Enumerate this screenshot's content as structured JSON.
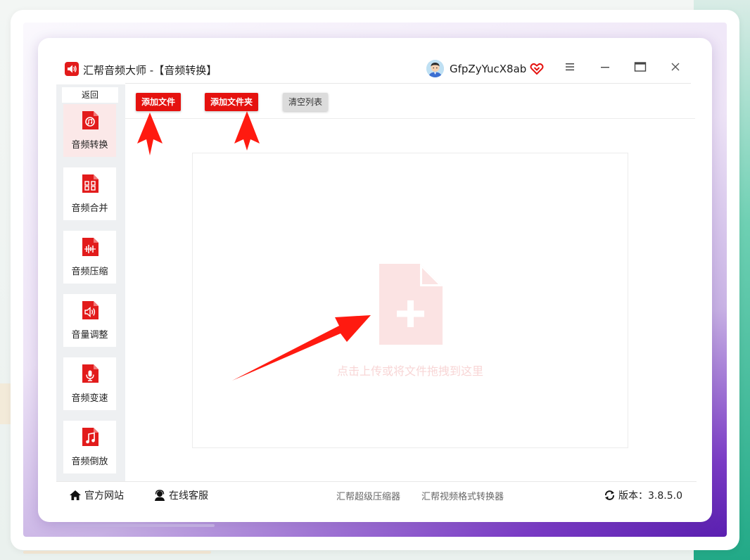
{
  "window": {
    "app_name": "汇帮音频大师",
    "title_suffix": " -【音频转换】",
    "username": "GfpZyYucX8ab"
  },
  "sidebar": {
    "back_label": "返回",
    "items": [
      {
        "label": "音频转换",
        "icon": "audio-convert-icon",
        "active": true
      },
      {
        "label": "音频合并",
        "icon": "audio-merge-icon",
        "active": false
      },
      {
        "label": "音频压缩",
        "icon": "audio-compress-icon",
        "active": false
      },
      {
        "label": "音量调整",
        "icon": "volume-adjust-icon",
        "active": false
      },
      {
        "label": "音频变速",
        "icon": "microphone-icon",
        "active": false
      },
      {
        "label": "音频倒放",
        "icon": "music-note-icon",
        "active": false
      }
    ]
  },
  "toolbar": {
    "add_file": "添加文件",
    "add_folder": "添加文件夹",
    "clear_list": "清空列表"
  },
  "dropzone": {
    "hint": "点击上传或将文件拖拽到这里"
  },
  "footer": {
    "official_site": "官方网站",
    "online_support": "在线客服",
    "link1": "汇帮超级压缩器",
    "link2": "汇帮视频格式转换器",
    "version": "版本：3.8.5.0"
  },
  "colors": {
    "accent": "#e5120f",
    "sidebar_bg": "#eef0f2",
    "active_item_bg": "#fbe8e8"
  }
}
